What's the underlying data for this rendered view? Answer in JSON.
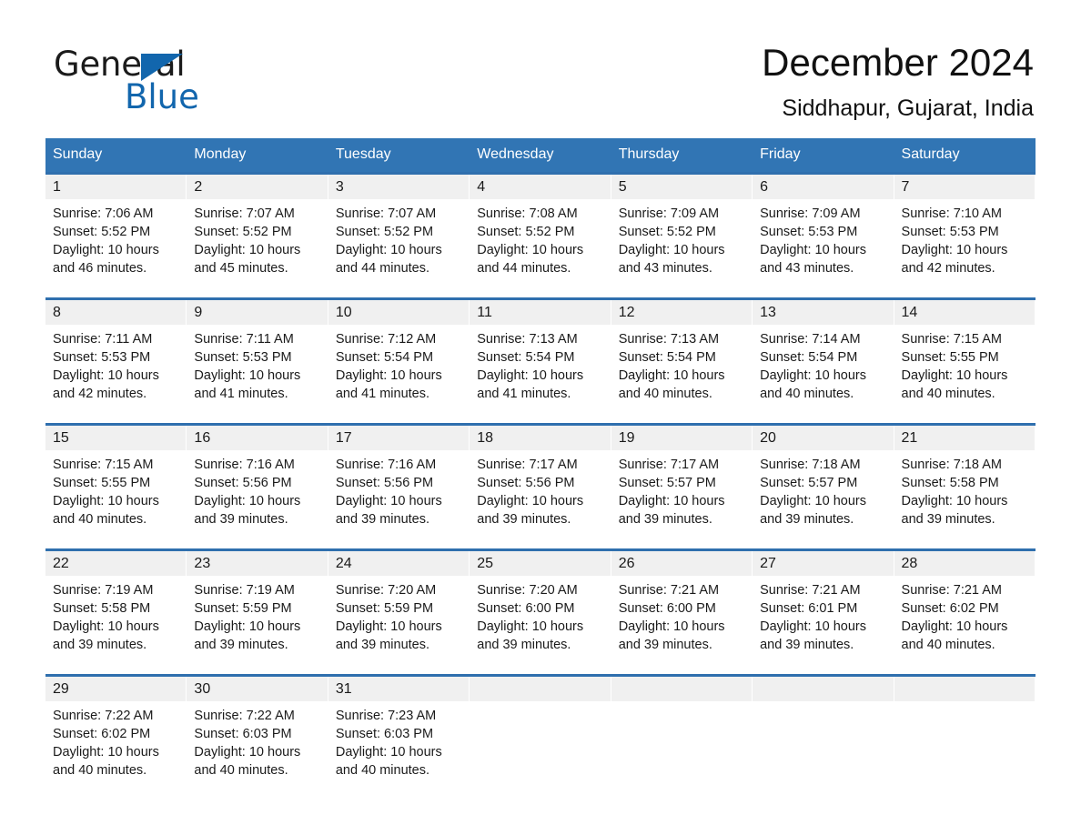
{
  "brand": {
    "name_part1": "General",
    "name_part2": "Blue",
    "flag_icon": "triangle-flag-icon",
    "accent_color": "#1266ad"
  },
  "header": {
    "title": "December 2024",
    "location": "Siddhapur, Gujarat, India"
  },
  "theme": {
    "header_blue": "#3175b4",
    "row_divider_blue": "#2f6fae",
    "daynum_band": "#f0f0f0"
  },
  "weekday_headers": [
    "Sunday",
    "Monday",
    "Tuesday",
    "Wednesday",
    "Thursday",
    "Friday",
    "Saturday"
  ],
  "weeks": [
    [
      {
        "day": "1",
        "sunrise": "Sunrise: 7:06 AM",
        "sunset": "Sunset: 5:52 PM",
        "daylight": "Daylight: 10 hours and 46 minutes."
      },
      {
        "day": "2",
        "sunrise": "Sunrise: 7:07 AM",
        "sunset": "Sunset: 5:52 PM",
        "daylight": "Daylight: 10 hours and 45 minutes."
      },
      {
        "day": "3",
        "sunrise": "Sunrise: 7:07 AM",
        "sunset": "Sunset: 5:52 PM",
        "daylight": "Daylight: 10 hours and 44 minutes."
      },
      {
        "day": "4",
        "sunrise": "Sunrise: 7:08 AM",
        "sunset": "Sunset: 5:52 PM",
        "daylight": "Daylight: 10 hours and 44 minutes."
      },
      {
        "day": "5",
        "sunrise": "Sunrise: 7:09 AM",
        "sunset": "Sunset: 5:52 PM",
        "daylight": "Daylight: 10 hours and 43 minutes."
      },
      {
        "day": "6",
        "sunrise": "Sunrise: 7:09 AM",
        "sunset": "Sunset: 5:53 PM",
        "daylight": "Daylight: 10 hours and 43 minutes."
      },
      {
        "day": "7",
        "sunrise": "Sunrise: 7:10 AM",
        "sunset": "Sunset: 5:53 PM",
        "daylight": "Daylight: 10 hours and 42 minutes."
      }
    ],
    [
      {
        "day": "8",
        "sunrise": "Sunrise: 7:11 AM",
        "sunset": "Sunset: 5:53 PM",
        "daylight": "Daylight: 10 hours and 42 minutes."
      },
      {
        "day": "9",
        "sunrise": "Sunrise: 7:11 AM",
        "sunset": "Sunset: 5:53 PM",
        "daylight": "Daylight: 10 hours and 41 minutes."
      },
      {
        "day": "10",
        "sunrise": "Sunrise: 7:12 AM",
        "sunset": "Sunset: 5:54 PM",
        "daylight": "Daylight: 10 hours and 41 minutes."
      },
      {
        "day": "11",
        "sunrise": "Sunrise: 7:13 AM",
        "sunset": "Sunset: 5:54 PM",
        "daylight": "Daylight: 10 hours and 41 minutes."
      },
      {
        "day": "12",
        "sunrise": "Sunrise: 7:13 AM",
        "sunset": "Sunset: 5:54 PM",
        "daylight": "Daylight: 10 hours and 40 minutes."
      },
      {
        "day": "13",
        "sunrise": "Sunrise: 7:14 AM",
        "sunset": "Sunset: 5:54 PM",
        "daylight": "Daylight: 10 hours and 40 minutes."
      },
      {
        "day": "14",
        "sunrise": "Sunrise: 7:15 AM",
        "sunset": "Sunset: 5:55 PM",
        "daylight": "Daylight: 10 hours and 40 minutes."
      }
    ],
    [
      {
        "day": "15",
        "sunrise": "Sunrise: 7:15 AM",
        "sunset": "Sunset: 5:55 PM",
        "daylight": "Daylight: 10 hours and 40 minutes."
      },
      {
        "day": "16",
        "sunrise": "Sunrise: 7:16 AM",
        "sunset": "Sunset: 5:56 PM",
        "daylight": "Daylight: 10 hours and 39 minutes."
      },
      {
        "day": "17",
        "sunrise": "Sunrise: 7:16 AM",
        "sunset": "Sunset: 5:56 PM",
        "daylight": "Daylight: 10 hours and 39 minutes."
      },
      {
        "day": "18",
        "sunrise": "Sunrise: 7:17 AM",
        "sunset": "Sunset: 5:56 PM",
        "daylight": "Daylight: 10 hours and 39 minutes."
      },
      {
        "day": "19",
        "sunrise": "Sunrise: 7:17 AM",
        "sunset": "Sunset: 5:57 PM",
        "daylight": "Daylight: 10 hours and 39 minutes."
      },
      {
        "day": "20",
        "sunrise": "Sunrise: 7:18 AM",
        "sunset": "Sunset: 5:57 PM",
        "daylight": "Daylight: 10 hours and 39 minutes."
      },
      {
        "day": "21",
        "sunrise": "Sunrise: 7:18 AM",
        "sunset": "Sunset: 5:58 PM",
        "daylight": "Daylight: 10 hours and 39 minutes."
      }
    ],
    [
      {
        "day": "22",
        "sunrise": "Sunrise: 7:19 AM",
        "sunset": "Sunset: 5:58 PM",
        "daylight": "Daylight: 10 hours and 39 minutes."
      },
      {
        "day": "23",
        "sunrise": "Sunrise: 7:19 AM",
        "sunset": "Sunset: 5:59 PM",
        "daylight": "Daylight: 10 hours and 39 minutes."
      },
      {
        "day": "24",
        "sunrise": "Sunrise: 7:20 AM",
        "sunset": "Sunset: 5:59 PM",
        "daylight": "Daylight: 10 hours and 39 minutes."
      },
      {
        "day": "25",
        "sunrise": "Sunrise: 7:20 AM",
        "sunset": "Sunset: 6:00 PM",
        "daylight": "Daylight: 10 hours and 39 minutes."
      },
      {
        "day": "26",
        "sunrise": "Sunrise: 7:21 AM",
        "sunset": "Sunset: 6:00 PM",
        "daylight": "Daylight: 10 hours and 39 minutes."
      },
      {
        "day": "27",
        "sunrise": "Sunrise: 7:21 AM",
        "sunset": "Sunset: 6:01 PM",
        "daylight": "Daylight: 10 hours and 39 minutes."
      },
      {
        "day": "28",
        "sunrise": "Sunrise: 7:21 AM",
        "sunset": "Sunset: 6:02 PM",
        "daylight": "Daylight: 10 hours and 40 minutes."
      }
    ],
    [
      {
        "day": "29",
        "sunrise": "Sunrise: 7:22 AM",
        "sunset": "Sunset: 6:02 PM",
        "daylight": "Daylight: 10 hours and 40 minutes."
      },
      {
        "day": "30",
        "sunrise": "Sunrise: 7:22 AM",
        "sunset": "Sunset: 6:03 PM",
        "daylight": "Daylight: 10 hours and 40 minutes."
      },
      {
        "day": "31",
        "sunrise": "Sunrise: 7:23 AM",
        "sunset": "Sunset: 6:03 PM",
        "daylight": "Daylight: 10 hours and 40 minutes."
      },
      {
        "day": "",
        "sunrise": "",
        "sunset": "",
        "daylight": ""
      },
      {
        "day": "",
        "sunrise": "",
        "sunset": "",
        "daylight": ""
      },
      {
        "day": "",
        "sunrise": "",
        "sunset": "",
        "daylight": ""
      },
      {
        "day": "",
        "sunrise": "",
        "sunset": "",
        "daylight": ""
      }
    ]
  ]
}
